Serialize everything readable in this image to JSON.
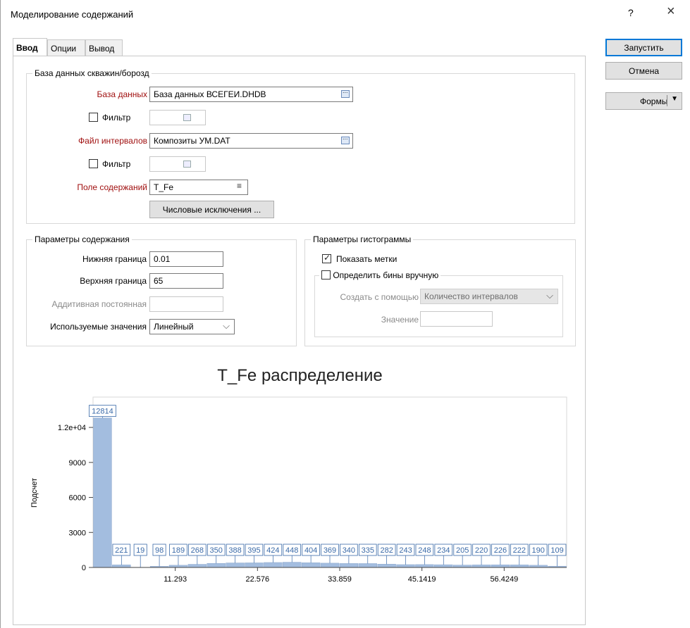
{
  "window": {
    "title": "Моделирование содержаний",
    "help": "?",
    "close": "×"
  },
  "tabs": [
    {
      "label": "Ввод"
    },
    {
      "label": "Опции"
    },
    {
      "label": "Вывод"
    }
  ],
  "buttons": {
    "run": "Запустить",
    "cancel": "Отмена",
    "forms": "Формы"
  },
  "db_group": {
    "title": "База данных скважин/борозд",
    "database_label": "База данных",
    "database_value": "База данных ВСЕГЕИ.DHDB",
    "filter1_label": "Фильтр",
    "interval_label": "Файл интервалов",
    "interval_value": "Композиты УМ.DAT",
    "filter2_label": "Фильтр",
    "grade_field_label": "Поле содержаний",
    "grade_field_value": "T_Fe",
    "numeric_exclusions": "Числовые исключения ..."
  },
  "grade_params": {
    "title": "Параметры содержания",
    "lower_label": "Нижняя граница",
    "lower_value": "0.01",
    "upper_label": "Верхняя граница",
    "upper_value": "65",
    "additive_label": "Аддитивная постоянная",
    "additive_value": "",
    "used_values_label": "Используемые значения",
    "used_values_value": "Линейный"
  },
  "histogram_params": {
    "title": "Параметры гистограммы",
    "show_labels": "Показать метки",
    "show_labels_checked": true,
    "manual_bins": "Определить бины вручную",
    "manual_bins_checked": false,
    "create_with_label": "Создать с помощью",
    "create_with_value": "Количество интервалов",
    "value_label": "Значение",
    "value_value": ""
  },
  "chart_data": {
    "type": "bar",
    "title": "T_Fe распределение",
    "ylabel": "Подсчет",
    "xlabel": "",
    "values": [
      12814,
      221,
      19,
      98,
      189,
      268,
      350,
      388,
      395,
      424,
      448,
      404,
      369,
      340,
      335,
      282,
      243,
      248,
      234,
      205,
      220,
      226,
      222,
      190,
      109
    ],
    "ylim": [
      0,
      14600
    ],
    "y_ticks": [
      0,
      3000,
      6000,
      9000,
      12000
    ],
    "y_tick_labels": [
      "0",
      "3000",
      "6000",
      "9000",
      "1.2e+04"
    ],
    "x_ticks": [
      11.293,
      22.576,
      33.859,
      45.1419,
      56.4249
    ],
    "x_tick_labels": [
      "11.293",
      "22.576",
      "33.859",
      "45.1419",
      "56.4249"
    ],
    "xlim": [
      0.01,
      65
    ],
    "bar_color": "#a3bddf",
    "label_color": "#3a6aa8"
  }
}
